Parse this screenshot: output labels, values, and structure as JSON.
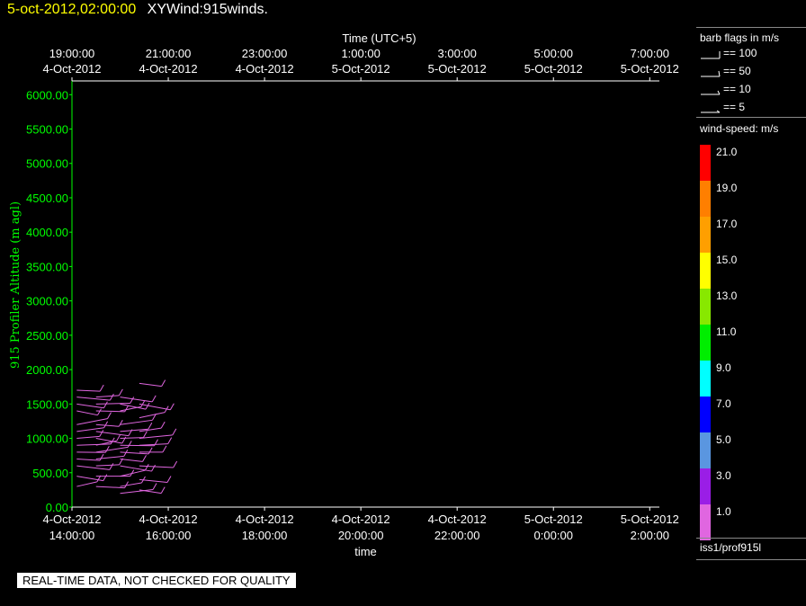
{
  "header": {
    "date": "5-oct-2012,02:00:00",
    "title": "XYWind:915winds."
  },
  "notice": "REAL-TIME DATA, NOT CHECKED FOR QUALITY",
  "sidebar": {
    "barb_title": "barb flags in m/s",
    "barb_items": [
      "== 100",
      "== 50",
      "== 10",
      "== 5"
    ],
    "speed_title": "wind-speed: m/s",
    "speed_scale": [
      {
        "label": "21.0",
        "color": "#ff0000"
      },
      {
        "label": "19.0",
        "color": "#ff7f00"
      },
      {
        "label": "17.0",
        "color": "#ff9f00"
      },
      {
        "label": "15.0",
        "color": "#ffff00"
      },
      {
        "label": "13.0",
        "color": "#88e800"
      },
      {
        "label": "11.0",
        "color": "#00ee00"
      },
      {
        "label": "9.0",
        "color": "#00ffff"
      },
      {
        "label": "7.0",
        "color": "#0000ff"
      },
      {
        "label": "5.0",
        "color": "#5a96e0"
      },
      {
        "label": "3.0",
        "color": "#9a1ee6"
      },
      {
        "label": "1.0",
        "color": "#e066e0"
      }
    ],
    "source": "iss1/prof915l"
  },
  "chart_data": {
    "type": "scatter",
    "top_axis_title": "Time (UTC+5)",
    "top_ticks": [
      [
        "19:00:00",
        "4-Oct-2012"
      ],
      [
        "21:00:00",
        "4-Oct-2012"
      ],
      [
        "23:00:00",
        "4-Oct-2012"
      ],
      [
        "1:00:00",
        "5-Oct-2012"
      ],
      [
        "3:00:00",
        "5-Oct-2012"
      ],
      [
        "5:00:00",
        "5-Oct-2012"
      ],
      [
        "7:00:00",
        "5-Oct-2012"
      ]
    ],
    "bottom_ticks": [
      [
        "4-Oct-2012",
        "14:00:00"
      ],
      [
        "4-Oct-2012",
        "16:00:00"
      ],
      [
        "4-Oct-2012",
        "18:00:00"
      ],
      [
        "4-Oct-2012",
        "20:00:00"
      ],
      [
        "4-Oct-2012",
        "22:00:00"
      ],
      [
        "5-Oct-2012",
        "0:00:00"
      ],
      [
        "5-Oct-2012",
        "2:00:00"
      ]
    ],
    "xlabel": "time",
    "ylabel": "915 Profiler Altitude (m agl)",
    "x_range_hours": [
      14,
      26.2
    ],
    "y_range": [
      0,
      6200
    ],
    "y_ticks": [
      0,
      500,
      1000,
      1500,
      2000,
      2500,
      3000,
      3500,
      4000,
      4500,
      5000,
      5500,
      6000
    ],
    "y_tick_labels": [
      "0.00",
      "500.00",
      "1000.00",
      "1500.00",
      "2000.00",
      "2500.00",
      "3000.00",
      "3500.00",
      "4000.00",
      "4500.00",
      "5000.00",
      "5500.00",
      "6000.00"
    ],
    "grid": false,
    "axis_color": "#00ff00",
    "barb_color": "#e066e0",
    "series": [
      {
        "time_hours": 14.1,
        "altitudes": [
          300,
          450,
          600,
          700,
          800,
          900,
          1000,
          1100,
          1200,
          1400,
          1500,
          1600,
          1700
        ]
      },
      {
        "time_hours": 14.5,
        "altitudes": [
          300,
          450,
          600,
          700,
          800,
          900,
          1000,
          1100,
          1200,
          1400,
          1500,
          1600
        ]
      },
      {
        "time_hours": 15.0,
        "altitudes": [
          200,
          300,
          450,
          600,
          700,
          800,
          900,
          1000,
          1100,
          1200,
          1400,
          1500,
          1600
        ]
      },
      {
        "time_hours": 15.4,
        "altitudes": [
          250,
          400,
          600,
          800,
          900,
          1000,
          1100,
          1300,
          1500,
          1800
        ]
      }
    ]
  }
}
